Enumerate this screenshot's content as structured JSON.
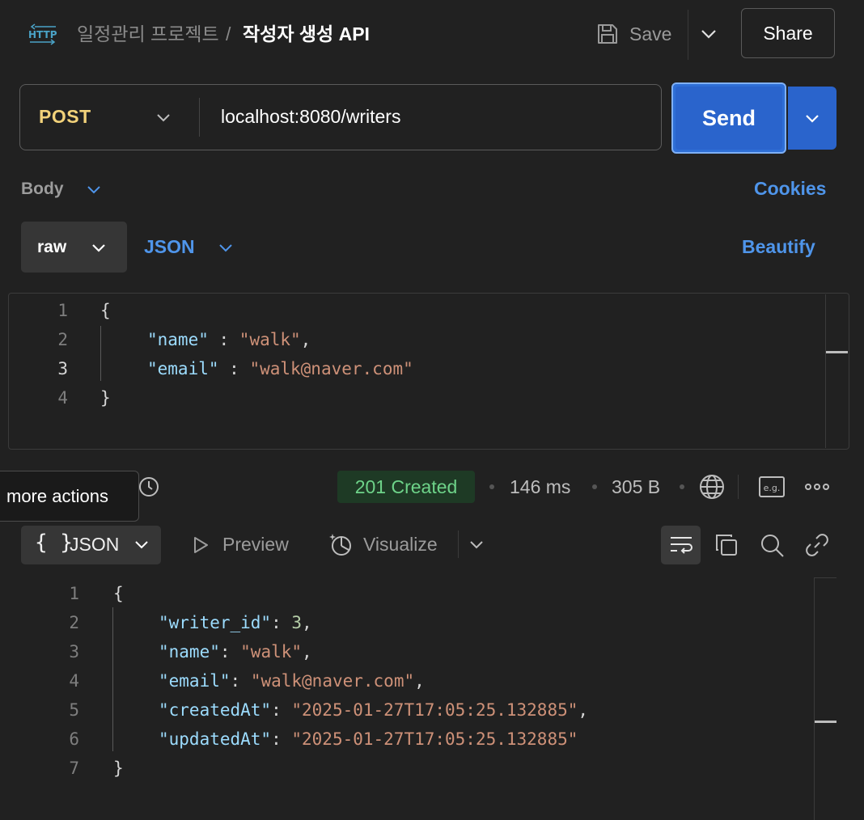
{
  "header": {
    "protocol_icon": "http-icon",
    "breadcrumb_parent": "일정관리 프로젝트",
    "breadcrumb_separator": "/",
    "request_title": "작성자 생성 API",
    "save_label": "Save",
    "share_label": "Share"
  },
  "request": {
    "method": "POST",
    "url": "localhost:8080/writers",
    "send_label": "Send"
  },
  "body_tabs": {
    "body_label": "Body",
    "cookies_label": "Cookies",
    "body_type": "raw",
    "format": "JSON",
    "beautify_label": "Beautify"
  },
  "request_body": {
    "line_numbers": [
      "1",
      "2",
      "3",
      "4"
    ],
    "open_brace": "{",
    "name_key": "\"name\"",
    "name_sep": " : ",
    "name_value": "\"walk\"",
    "name_comma": ",",
    "email_key": "\"email\"",
    "email_sep": " : ",
    "email_value": "\"walk@naver.com\"",
    "close_brace": "}"
  },
  "response_meta": {
    "tooltip": "more actions",
    "status": "201 Created",
    "time": "146 ms",
    "size": "305 B",
    "status_color": "#6ed389"
  },
  "response_toolbar": {
    "format_icon": "{ }",
    "format": "JSON",
    "preview_label": "Preview",
    "visualize_label": "Visualize"
  },
  "response_body": {
    "line_numbers": [
      "1",
      "2",
      "3",
      "4",
      "5",
      "6",
      "7"
    ],
    "open_brace": "{",
    "writer_id_key": "\"writer_id\"",
    "writer_id_value": "3",
    "name_key": "\"name\"",
    "name_value": "\"walk\"",
    "email_key": "\"email\"",
    "email_value": "\"walk@naver.com\"",
    "created_key": "\"createdAt\"",
    "created_value": "\"2025-01-27T17:05:25.132885\"",
    "updated_key": "\"updatedAt\"",
    "updated_value": "\"2025-01-27T17:05:25.132885\"",
    "close_brace": "}",
    "colon": ": ",
    "comma": ","
  },
  "colors": {
    "accent": "#2f6fd6",
    "link": "#4f95ea",
    "method": "#f2d27a",
    "json_key": "#9cdcfe",
    "json_string": "#ce9178",
    "json_number": "#b5cea8"
  }
}
